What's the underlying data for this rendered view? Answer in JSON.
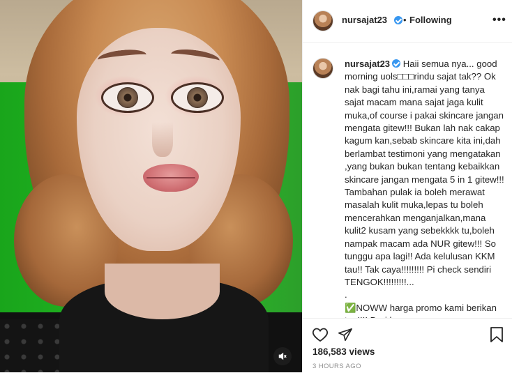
{
  "post": {
    "author": "nursajat23",
    "header_separator": "•",
    "follow_status": "Following",
    "more_label": "•••",
    "caption": "Haii semua nya... good morning uols□□□rindu sajat tak?? Ok nak bagi tahu ini,ramai yang tanya sajat macam mana sajat jaga kulit muka,of course i pakai skincare jangan mengata gitew!!! Bukan lah nak cakap kagum kan,sebab skincare kita ini,dah berlambat testimoni yang mengatakan ,yang bukan bukan tentang kebaikkan skincare jangan mengata 5 in 1 gitew!!! Tambahan pulak ia boleh merawat masalah kulit muka,lepas tu boleh mencerahkan menganjalkan,mana kulit2 kusam yang sebekkkk tu,boleh nampak macam ada NUR gitew!!! So tunggu apa lagi!! Ada kelulusan KKM tau!! Tak caya!!!!!!!!! Pi check sendiri TENGOK!!!!!!!!!...\n.\n✅NOWW harga promo kami berikan tau!!!! Dari harga",
    "views": "186,583 views",
    "time_ago": "3 HOURS AGO"
  },
  "icons": {
    "verified": "verified-badge-icon",
    "like": "heart-icon",
    "share": "paper-plane-icon",
    "save": "bookmark-icon",
    "mute": "muted-speaker-icon"
  },
  "colors": {
    "verified": "#3897f0",
    "text": "#262626",
    "muted_text": "#8e8e8e"
  }
}
